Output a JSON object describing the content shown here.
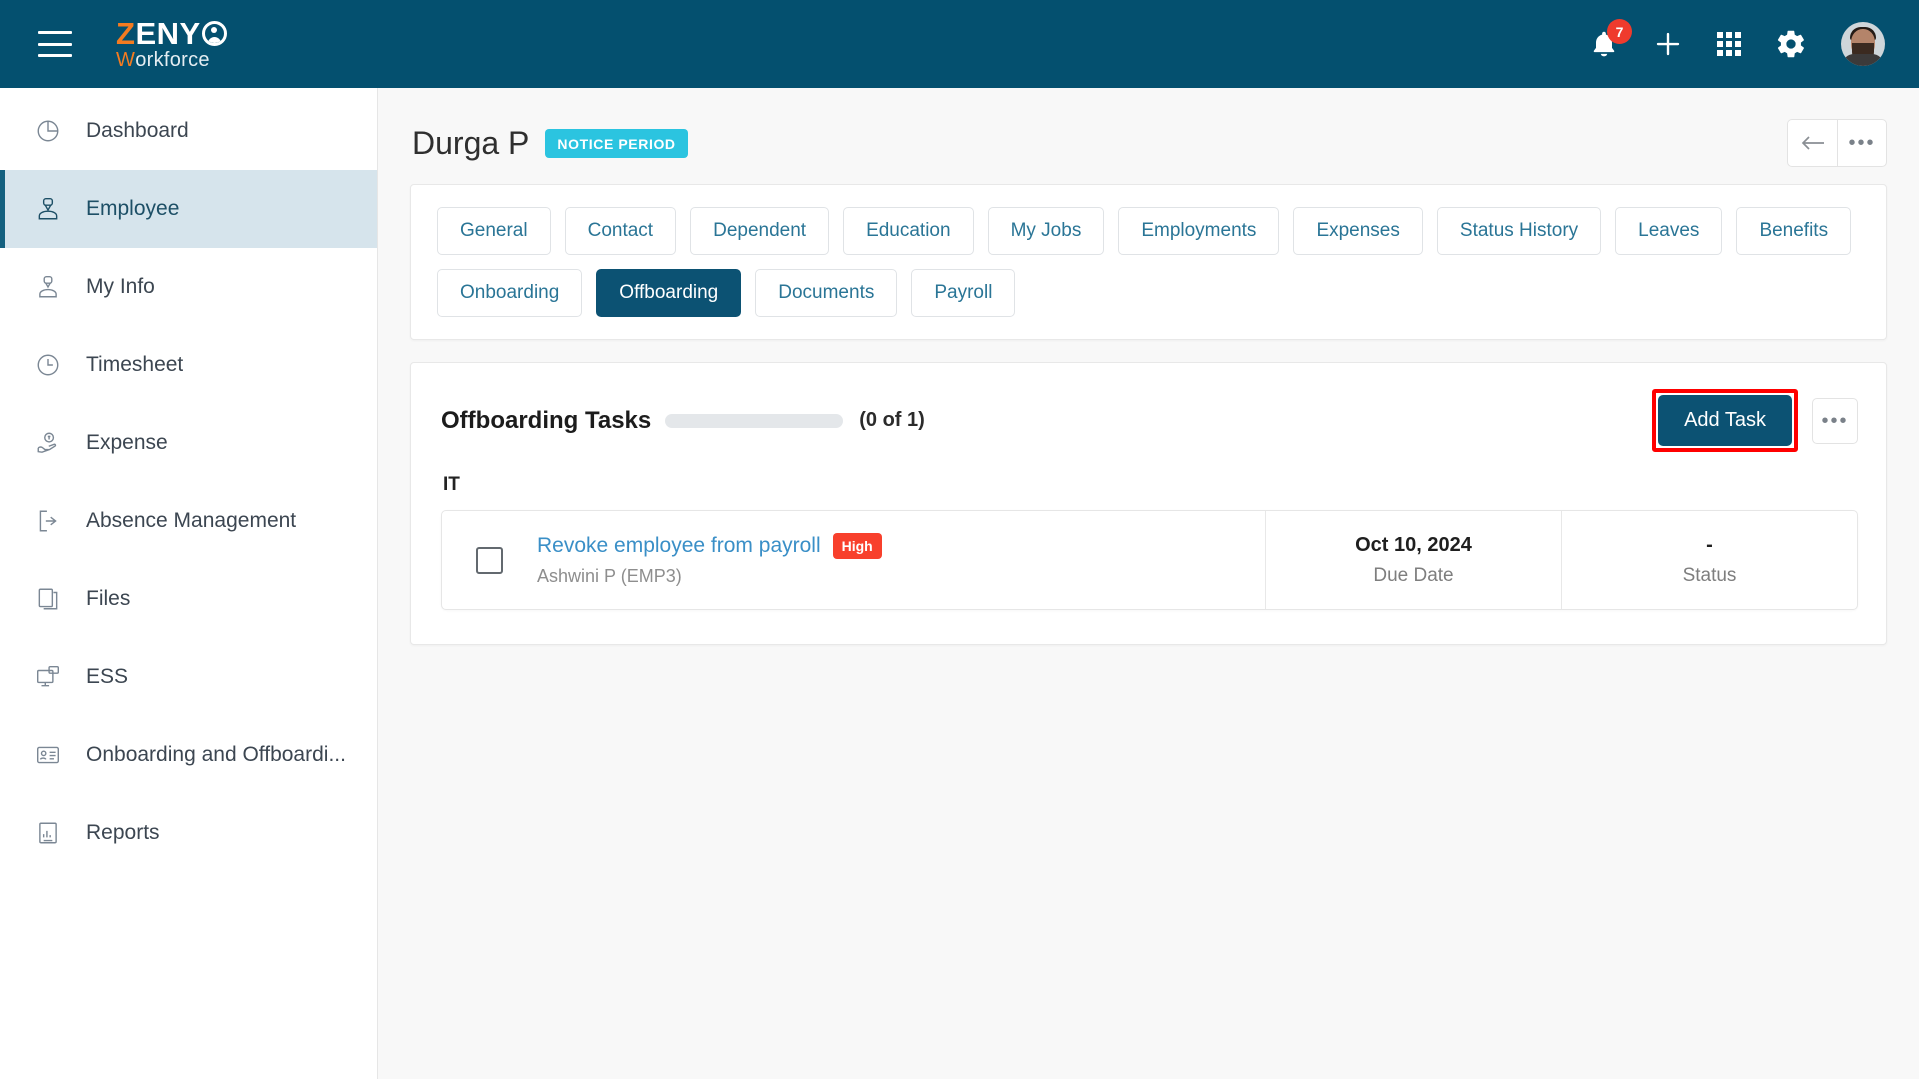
{
  "header": {
    "menu_icon": "hamburger-icon",
    "logo": {
      "part1": "Z",
      "part2": "ENY",
      "part3": "W",
      "part4": "orkforce",
      "mark": "person-circle-icon"
    },
    "notifications": {
      "icon": "bell-icon",
      "count": "7"
    },
    "add_icon": "plus-icon",
    "apps_icon": "grid-apps-icon",
    "settings_icon": "gear-icon",
    "avatar": "user-avatar"
  },
  "sidebar": {
    "items": [
      {
        "label": "Dashboard",
        "icon": "pie-chart-icon",
        "active": false
      },
      {
        "label": "Employee",
        "icon": "employee-icon",
        "active": true
      },
      {
        "label": "My Info",
        "icon": "my-info-icon",
        "active": false
      },
      {
        "label": "Timesheet",
        "icon": "clock-icon",
        "active": false
      },
      {
        "label": "Expense",
        "icon": "expense-hand-icon",
        "active": false
      },
      {
        "label": "Absence Management",
        "icon": "exit-door-icon",
        "active": false
      },
      {
        "label": "Files",
        "icon": "files-icon",
        "active": false
      },
      {
        "label": "ESS",
        "icon": "ess-monitor-icon",
        "active": false
      },
      {
        "label": "Onboarding and Offboardi...",
        "icon": "id-card-icon",
        "active": false
      },
      {
        "label": "Reports",
        "icon": "reports-icon",
        "active": false
      }
    ]
  },
  "page": {
    "title": "Durga P",
    "status_badge": "NOTICE PERIOD",
    "back_icon": "back-arrow-icon",
    "more_icon": "more-dots-icon"
  },
  "tabs": {
    "row1": [
      {
        "label": "General",
        "active": false
      },
      {
        "label": "Contact",
        "active": false
      },
      {
        "label": "Dependent",
        "active": false
      },
      {
        "label": "Education",
        "active": false
      },
      {
        "label": "My Jobs",
        "active": false
      },
      {
        "label": "Employments",
        "active": false
      },
      {
        "label": "Expenses",
        "active": false
      },
      {
        "label": "Status History",
        "active": false
      },
      {
        "label": "Leaves",
        "active": false
      },
      {
        "label": "Benefits",
        "active": false
      }
    ],
    "row2": [
      {
        "label": "Onboarding",
        "active": false
      },
      {
        "label": "Offboarding",
        "active": true
      },
      {
        "label": "Documents",
        "active": false
      },
      {
        "label": "Payroll",
        "active": false
      }
    ]
  },
  "tasks_panel": {
    "title": "Offboarding Tasks",
    "count_text": "(0 of 1)",
    "progress_percent": 0,
    "add_button": "Add Task",
    "more_icon": "more-dots-icon",
    "group_label": "IT",
    "columns": {
      "due_date_label": "Due Date",
      "status_label": "Status"
    },
    "rows": [
      {
        "checked": false,
        "title": "Revoke employee from payroll",
        "priority": "High",
        "assignee": "Ashwini P (EMP3)",
        "due_date": "Oct 10, 2024",
        "status": "-"
      }
    ]
  },
  "colors": {
    "header_bg": "#04506f",
    "accent": "#0c5273",
    "logo_orange": "#f47b20",
    "status_badge": "#2bc4e0",
    "priority_high": "#f8402c",
    "link": "#3a8fc7",
    "highlight_box": "#ff0000",
    "sidebar_active_bg": "#d6e4ec"
  }
}
